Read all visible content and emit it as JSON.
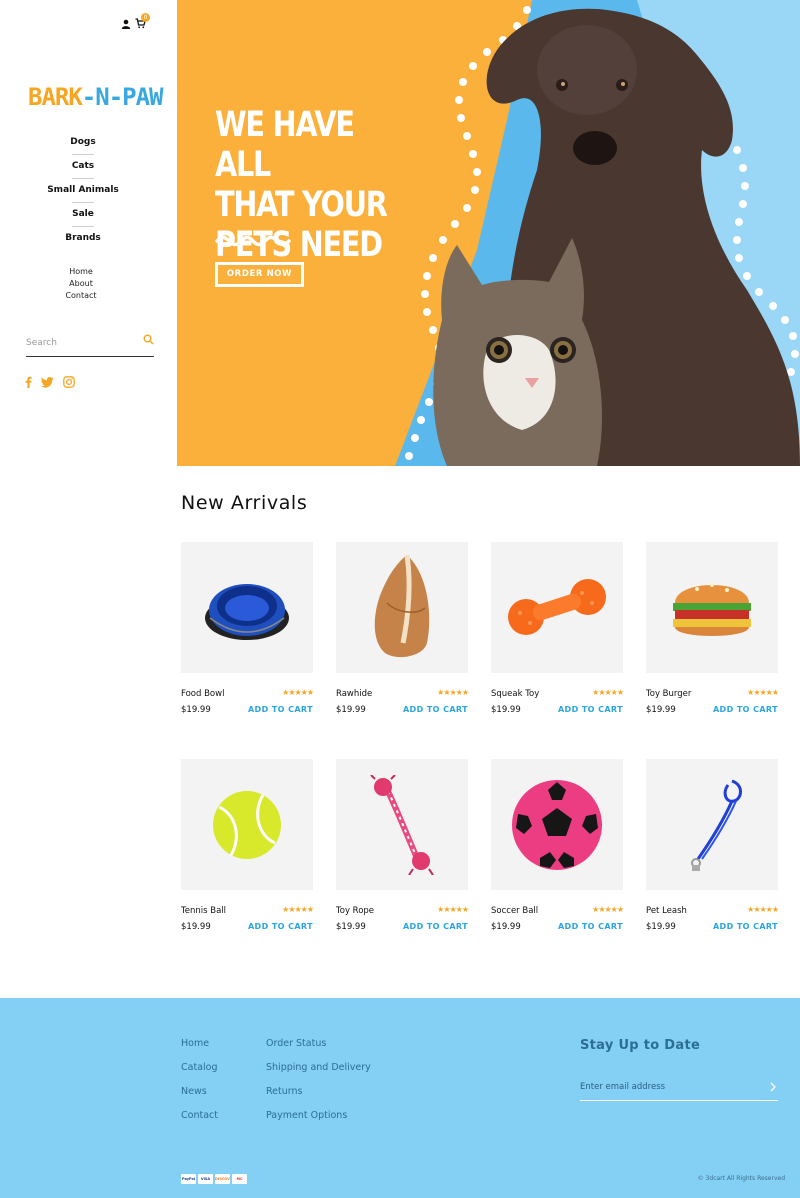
{
  "header": {
    "cart_count": "0"
  },
  "brand": {
    "logo_part1": "BARK",
    "logo_part2": "-N-",
    "logo_part3": "PAW",
    "colors": {
      "orange": "#f5a623",
      "blue": "#3aa8e0",
      "hero_orange": "#fbb03b",
      "footer_blue": "#84cff4"
    }
  },
  "sidebar": {
    "categories": [
      "Dogs",
      "Cats",
      "Small Animals",
      "Sale",
      "Brands"
    ],
    "pages": [
      "Home",
      "About",
      "Contact"
    ],
    "search_placeholder": "Search",
    "social_icons": [
      "facebook-icon",
      "twitter-icon",
      "instagram-icon"
    ]
  },
  "hero": {
    "title_line1": "WE HAVE ALL",
    "title_line2": "THAT YOUR",
    "title_line3": "PETS NEED",
    "cta_label": "ORDER NOW"
  },
  "new_arrivals": {
    "title": "New Arrivals",
    "products": [
      {
        "name": "Food Bowl",
        "price": "$19.99",
        "rating": 5,
        "cta": "ADD TO CART"
      },
      {
        "name": "Rawhide",
        "price": "$19.99",
        "rating": 5,
        "cta": "ADD TO CART"
      },
      {
        "name": "Squeak Toy",
        "price": "$19.99",
        "rating": 5,
        "cta": "ADD TO CART"
      },
      {
        "name": "Toy Burger",
        "price": "$19.99",
        "rating": 5,
        "cta": "ADD TO CART"
      },
      {
        "name": "Tennis Ball",
        "price": "$19.99",
        "rating": 5,
        "cta": "ADD TO CART"
      },
      {
        "name": "Toy Rope",
        "price": "$19.99",
        "rating": 5,
        "cta": "ADD TO CART"
      },
      {
        "name": "Soccer Ball",
        "price": "$19.99",
        "rating": 5,
        "cta": "ADD TO CART"
      },
      {
        "name": "Pet Leash",
        "price": "$19.99",
        "rating": 5,
        "cta": "ADD TO CART"
      }
    ]
  },
  "footer": {
    "col1": [
      "Home",
      "Catalog",
      "News",
      "Contact"
    ],
    "col2": [
      "Order Status",
      "Shipping and Delivery",
      "Returns",
      "Payment Options"
    ],
    "newsletter_title": "Stay Up to Date",
    "email_placeholder": "Enter email address",
    "payment_labels": [
      "PayPal",
      "VISA",
      "DISCOVER",
      "MC"
    ],
    "copyright": "© 3dcart All Rights Reserved"
  }
}
